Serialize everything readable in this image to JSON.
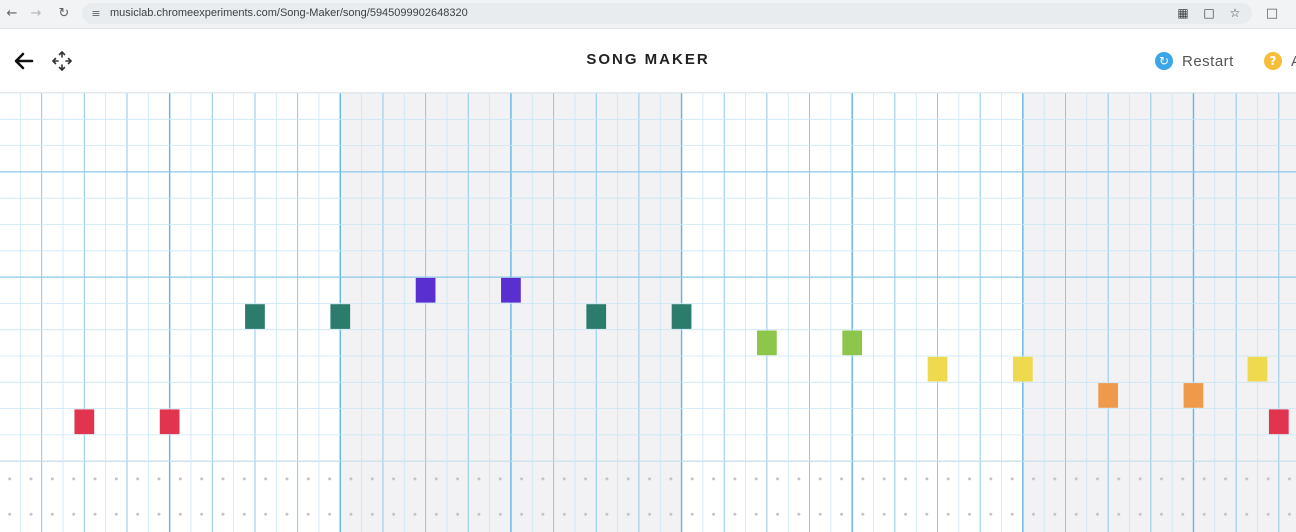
{
  "browser": {
    "url": "musiclab.chromeexperiments.com/Song-Maker/song/5945099902648320",
    "icons": [
      "back-arrow-icon",
      "forward-arrow-icon",
      "reload-icon",
      "site-info-icon",
      "reader-mode-icon",
      "translate-icon",
      "bookmark-star-icon",
      "extensions-icon"
    ]
  },
  "header": {
    "title": "SONG MAKER",
    "restart_label": "Restart",
    "about_label": "A",
    "icons": [
      "back-arrow-icon",
      "move-icon",
      "restart-icon",
      "help-icon"
    ]
  },
  "grid": {
    "rows": 14,
    "columns": 60,
    "columns_per_beat": 2,
    "columns_per_bar": 8,
    "percussion_rows": 2,
    "shaded_bars": [
      2,
      3,
      6,
      7
    ],
    "colors": {
      "grid_line": "#c9e6f5",
      "beat_line": "#8cc8ea",
      "octave_line": "#8cc8ea",
      "shade": "#f2f2f4",
      "percussion_dot": "#c5c5c5"
    },
    "notes": [
      {
        "col": 4,
        "row": 13,
        "color": "#e0344f"
      },
      {
        "col": 8,
        "row": 13,
        "color": "#e0344f"
      },
      {
        "col": 12,
        "row": 9,
        "color": "#2b7c6b"
      },
      {
        "col": 16,
        "row": 9,
        "color": "#2b7c6b"
      },
      {
        "col": 20,
        "row": 8,
        "color": "#5a2fd0"
      },
      {
        "col": 24,
        "row": 8,
        "color": "#5a2fd0"
      },
      {
        "col": 28,
        "row": 9,
        "color": "#2b7c6b"
      },
      {
        "col": 32,
        "row": 9,
        "color": "#2b7c6b"
      },
      {
        "col": 36,
        "row": 10,
        "color": "#8dc64b"
      },
      {
        "col": 40,
        "row": 10,
        "color": "#8dc64b"
      },
      {
        "col": 44,
        "row": 11,
        "color": "#eed94f"
      },
      {
        "col": 48,
        "row": 11,
        "color": "#eed94f"
      },
      {
        "col": 52,
        "row": 12,
        "color": "#ef9a4a"
      },
      {
        "col": 56,
        "row": 12,
        "color": "#ef9a4a"
      },
      {
        "col": 59,
        "row": 11,
        "color": "#eed94f"
      },
      {
        "col": 60,
        "row": 13,
        "color": "#e0344f"
      }
    ]
  }
}
